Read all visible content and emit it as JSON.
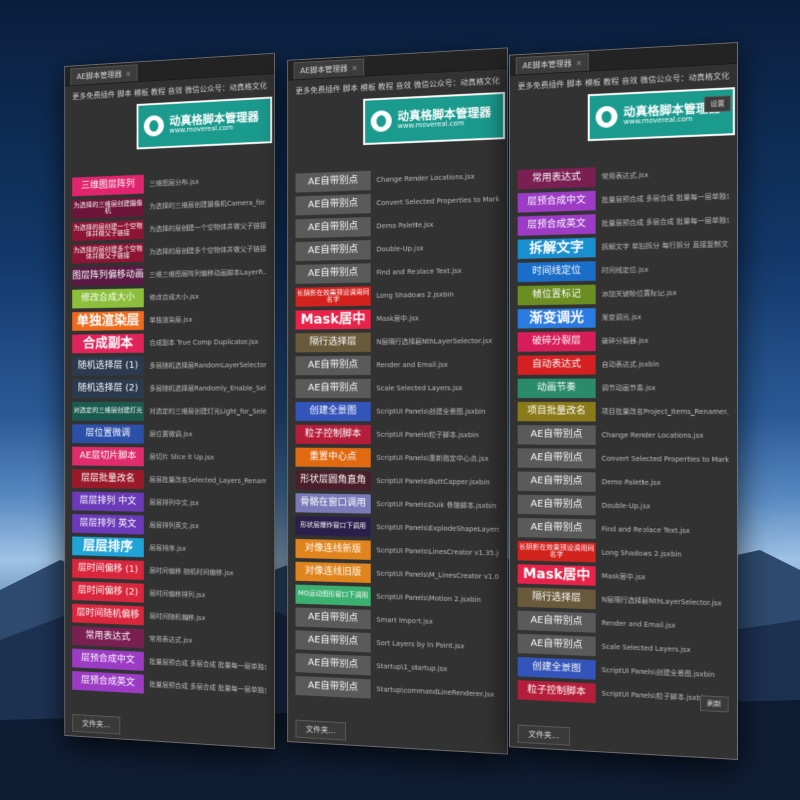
{
  "panels": [
    {
      "tab": "AE脚本管理器",
      "menu": "更多免费插件 脚本 模板 教程 音效 微信公众号：动真格文化",
      "logo": {
        "title": "动真格脚本管理器",
        "url": "www.movereal.com"
      },
      "settings": "",
      "folder": "文件夹...",
      "side": "",
      "items": [
        {
          "label": "三维图层阵列",
          "color": "#e0246e",
          "desc": "三维图层分布.jsx",
          "style": ""
        },
        {
          "label": "为选择的三维层创建摄像机",
          "color": "#6d1538",
          "desc": "为选择的三维层创建摄像机Camera_for...",
          "style": "tiny"
        },
        {
          "label": "为选择的层创建一个空物体并做父子链接",
          "color": "#8c1535",
          "desc": "为选择的层创建一个空物体并做父子链接",
          "style": "tiny"
        },
        {
          "label": "为选择的层创建多个空物体并做父子链接",
          "color": "#8c1535",
          "desc": "为选择的层创建多个空物体并做父子链接",
          "style": "tiny"
        },
        {
          "label": "图层阵列偏移动画",
          "color": "#5a1842",
          "desc": "三维三维图层阵列偏移动画脚本LayerR...",
          "style": ""
        },
        {
          "label": "修改合成大小",
          "color": "#8bbf3c",
          "desc": "修改合成大小.jsx",
          "style": ""
        },
        {
          "label": "单独渲染层",
          "color": "#ee6a1c",
          "desc": "单独渲染层.jsx",
          "style": "big"
        },
        {
          "label": "合成副本",
          "color": "#e0245a",
          "desc": "合成副本 True Comp Duplicator.jsx",
          "style": "big"
        },
        {
          "label": "随机选择层 (1)",
          "color": "#2b3a4e",
          "desc": "多层随机选择层RandomLayerSelector.jsx",
          "style": ""
        },
        {
          "label": "随机选择层 (2)",
          "color": "#2b3a4e",
          "desc": "多层随机选择层Randomly_Enable_Sele...",
          "style": ""
        },
        {
          "label": "对选定的三维层创建灯光",
          "color": "#1b5a4e",
          "desc": "对选定的三维层创建灯光Light_for_Sele...",
          "style": "tiny"
        },
        {
          "label": "层位置微调",
          "color": "#2c4fa8",
          "desc": "层位置微调.jsx",
          "style": ""
        },
        {
          "label": "AE层切片脚本",
          "color": "#e02c6a",
          "desc": "层切片 Slice it Up.jsx",
          "style": ""
        },
        {
          "label": "层层批量改名",
          "color": "#9a1a2a",
          "desc": "层层批量改名Selected_Layers_Renamer...",
          "style": ""
        },
        {
          "label": "层层排列 中文",
          "color": "#6b3ab8",
          "desc": "层层排列中文.jsx",
          "style": ""
        },
        {
          "label": "层层排列 英文",
          "color": "#6b3ab8",
          "desc": "层层排列英文.jsx",
          "style": ""
        },
        {
          "label": "层层排序",
          "color": "#20a3d6",
          "desc": "层层排序.jsx",
          "style": "big"
        },
        {
          "label": "层时间偏移 (1)",
          "color": "#d9263c",
          "desc": "层时间偏移 随机时间偏移.jsx",
          "style": ""
        },
        {
          "label": "层时间偏移 (2)",
          "color": "#d9263c",
          "desc": "层时间偏移排列.jsx",
          "style": ""
        },
        {
          "label": "层时间随机偏移",
          "color": "#d9263c",
          "desc": "层时间随机偏移.jsx",
          "style": ""
        },
        {
          "label": "常用表达式",
          "color": "#7a1f52",
          "desc": "常用表达式.jsx",
          "style": ""
        },
        {
          "label": "层预合成中文",
          "color": "#9c3bc4",
          "desc": "批量层预合成 多层合成 批量每一层单独合成",
          "style": ""
        },
        {
          "label": "层预合成英文",
          "color": "#9c3bc4",
          "desc": "批量层预合成 多层合成 批量每一层单独合成",
          "style": ""
        }
      ]
    },
    {
      "tab": "AE脚本管理器",
      "menu": "更多免费插件 脚本 模板 教程 音效 微信公众号：动真格文化",
      "logo": {
        "title": "动真格脚本管理器",
        "url": "www.movereal.com"
      },
      "settings": "",
      "folder": "文件夹...",
      "side": "",
      "items": [
        {
          "label": "AE自带别点",
          "color": "#5a5a5a",
          "desc": "Change Render Locations.jsx",
          "style": ""
        },
        {
          "label": "AE自带别点",
          "color": "#5a5a5a",
          "desc": "Convert Selected Properties to Markers.jsx",
          "style": ""
        },
        {
          "label": "AE自带别点",
          "color": "#5a5a5a",
          "desc": "Demo Palette.jsx",
          "style": ""
        },
        {
          "label": "AE自带别点",
          "color": "#5a5a5a",
          "desc": "Double-Up.jsx",
          "style": ""
        },
        {
          "label": "AE自带别点",
          "color": "#5a5a5a",
          "desc": "Find and Replace Text.jsx",
          "style": ""
        },
        {
          "label": "长阴影在效果预设调用同名字",
          "color": "#d2221e",
          "desc": "Long Shadows 2.jsxbin",
          "style": "tiny"
        },
        {
          "label": "Mask居中",
          "color": "#e8234a",
          "desc": "Mask居中.jsx",
          "style": "big"
        },
        {
          "label": "隔行选择层",
          "color": "#6a5a3c",
          "desc": "N层隔行选择层NthLayerSelector.jsx",
          "style": ""
        },
        {
          "label": "AE自带别点",
          "color": "#5a5a5a",
          "desc": "Render and Email.jsx",
          "style": ""
        },
        {
          "label": "AE自带别点",
          "color": "#5a5a5a",
          "desc": "Scale Selected Layers.jsx",
          "style": ""
        },
        {
          "label": "创建全景图",
          "color": "#3354b8",
          "desc": "ScriptUI Panels\\创建全景图.jsxbin",
          "style": ""
        },
        {
          "label": "粒子控制脚本",
          "color": "#b41e3a",
          "desc": "ScriptUI Panels\\粒子脚本.jsxbin",
          "style": ""
        },
        {
          "label": "重置中心点",
          "color": "#e06a12",
          "desc": "ScriptUI Panels\\重新指定中心点.jsx",
          "style": ""
        },
        {
          "label": "形状层圆角直角",
          "color": "#4a1e2a",
          "desc": "ScriptUI Panels\\ButtCapper.jsxbin",
          "style": ""
        },
        {
          "label": "骨骼在窗口调用",
          "color": "#7a7ab8",
          "desc": "ScriptUI Panels\\Duik 骨骼脚本.jsxbin",
          "style": ""
        },
        {
          "label": "形状层爆炸窗口下调用",
          "color": "#2a1e4a",
          "desc": "ScriptUI Panels\\ExplodeShapeLayers.jsxbin",
          "style": "tiny"
        },
        {
          "label": "对像连线新版",
          "color": "#e0851e",
          "desc": "ScriptUI Panels\\LinesCreator v1.35.jsxbin",
          "style": ""
        },
        {
          "label": "对像连线旧版",
          "color": "#e0851e",
          "desc": "ScriptUI Panels\\M_LinesCreator v1.01.jsxbin",
          "style": ""
        },
        {
          "label": "MG运动图形窗口下调用",
          "color": "#3bb070",
          "desc": "ScriptUI Panels\\Motion 2.jsxbin",
          "style": "tiny"
        },
        {
          "label": "AE自带别点",
          "color": "#5a5a5a",
          "desc": "Smart Import.jsx",
          "style": ""
        },
        {
          "label": "AE自带别点",
          "color": "#5a5a5a",
          "desc": "Sort Layers by In Point.jsx",
          "style": ""
        },
        {
          "label": "AE自带别点",
          "color": "#5a5a5a",
          "desc": "Startup\\1_startup.jsx",
          "style": ""
        },
        {
          "label": "AE自带别点",
          "color": "#5a5a5a",
          "desc": "Startup\\commandLineRenderer.jsx",
          "style": ""
        }
      ]
    },
    {
      "tab": "AE脚本管理器",
      "menu": "更多免费插件 脚本 模板 教程 音效 微信公众号：动真格文化",
      "logo": {
        "title": "动真格脚本管理器",
        "url": "www.movereal.com"
      },
      "settings": "设置",
      "folder": "文件夹...",
      "side": "刷新",
      "items": [
        {
          "label": "常用表达式",
          "color": "#7a1f52",
          "desc": "常用表达式.jsx",
          "style": ""
        },
        {
          "label": "层预合成中文",
          "color": "#9c3bc4",
          "desc": "批量层预合成 多层合成 批量每一层单独合成 可以指定名称 中文",
          "style": ""
        },
        {
          "label": "层预合成英文",
          "color": "#9c3bc4",
          "desc": "批量层预合成 多层合成 批量每一层单独合成 可以指定名称 英文",
          "style": ""
        },
        {
          "label": "拆解文字",
          "color": "#1a8fd0",
          "desc": "拆解文字 单独拆分 每行拆分 直接复制文本内容.jsx",
          "style": "big"
        },
        {
          "label": "时间线定位",
          "color": "#1a6ec8",
          "desc": "时间线定位.jsx",
          "style": ""
        },
        {
          "label": "帧位置标记",
          "color": "#6b8e23",
          "desc": "添加关键帧位置标记.jsx",
          "style": ""
        },
        {
          "label": "渐变调光",
          "color": "#2a7ae0",
          "desc": "渐变调光.jsx",
          "style": "big"
        },
        {
          "label": "破碎分裂层",
          "color": "#d81e5a",
          "desc": "破碎分裂器.jsx",
          "style": ""
        },
        {
          "label": "自动表达式",
          "color": "#d42020",
          "desc": "自动表达式.jsxbin",
          "style": ""
        },
        {
          "label": "动画节奏",
          "color": "#2a8a6a",
          "desc": "调节动画节奏.jsx",
          "style": ""
        },
        {
          "label": "项目批量改名",
          "color": "#8a7a1a",
          "desc": "项目批量改名Project_Items_Renamer.jsx",
          "style": ""
        },
        {
          "label": "AE自带别点",
          "color": "#5a5a5a",
          "desc": "Change Render Locations.jsx",
          "style": ""
        },
        {
          "label": "AE自带别点",
          "color": "#5a5a5a",
          "desc": "Convert Selected Properties to Markers.jsx",
          "style": ""
        },
        {
          "label": "AE自带别点",
          "color": "#5a5a5a",
          "desc": "Demo Palette.jsx",
          "style": ""
        },
        {
          "label": "AE自带别点",
          "color": "#5a5a5a",
          "desc": "Double-Up.jsx",
          "style": ""
        },
        {
          "label": "AE自带别点",
          "color": "#5a5a5a",
          "desc": "Find and Replace Text.jsx",
          "style": ""
        },
        {
          "label": "长阴影在效果预设调用同名字",
          "color": "#d2221e",
          "desc": "Long Shadows 2.jsxbin",
          "style": "tiny"
        },
        {
          "label": "Mask居中",
          "color": "#e8234a",
          "desc": "Mask居中.jsx",
          "style": "big"
        },
        {
          "label": "隔行选择层",
          "color": "#6a5a3c",
          "desc": "N层隔行选择层NthLayerSelector.jsx",
          "style": ""
        },
        {
          "label": "AE自带别点",
          "color": "#5a5a5a",
          "desc": "Render and Email.jsx",
          "style": ""
        },
        {
          "label": "AE自带别点",
          "color": "#5a5a5a",
          "desc": "Scale Selected Layers.jsx",
          "style": ""
        },
        {
          "label": "创建全景图",
          "color": "#3354b8",
          "desc": "ScriptUI Panels\\创建全景图.jsxbin",
          "style": ""
        },
        {
          "label": "粒子控制脚本",
          "color": "#b41e3a",
          "desc": "ScriptUI Panels\\粒子脚本.jsxbin",
          "style": ""
        }
      ]
    }
  ]
}
